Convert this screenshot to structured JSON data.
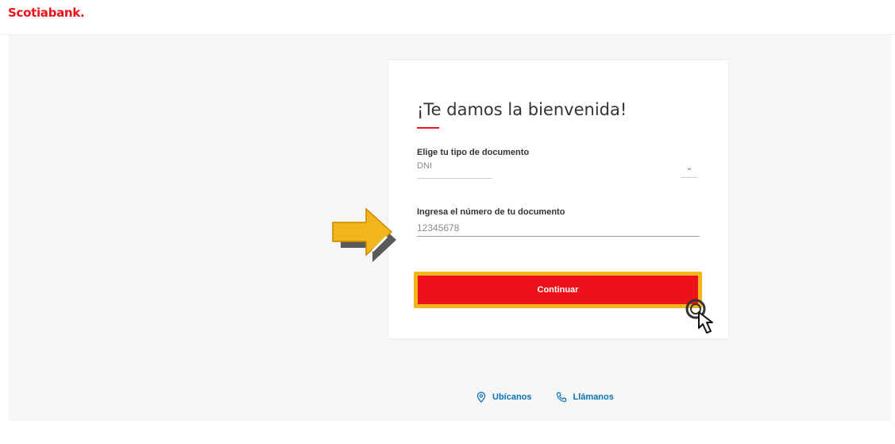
{
  "header": {
    "logo_text": "Scotiabank",
    "logo_dot": "."
  },
  "card": {
    "title": "¡Te damos la bienvenida!",
    "doc_type": {
      "label": "Elige tu tipo de documento",
      "selected_value": "DNI",
      "chevron_glyph": "⌄"
    },
    "doc_number": {
      "label": "Ingresa el número de tu documento",
      "value": "12345678"
    },
    "continue_label": "Continuar"
  },
  "footer": {
    "locate_label": "Ubícanos",
    "call_label": "Llámanos"
  },
  "colors": {
    "brand_red": "#ec111a",
    "highlight_yellow": "#f2b51c",
    "link_blue": "#0a74b8"
  },
  "icons": {
    "pointer_arrow": "yellow-arrow-icon",
    "cursor": "hand-cursor-icon",
    "location": "location-pin-icon",
    "phone": "phone-icon"
  }
}
